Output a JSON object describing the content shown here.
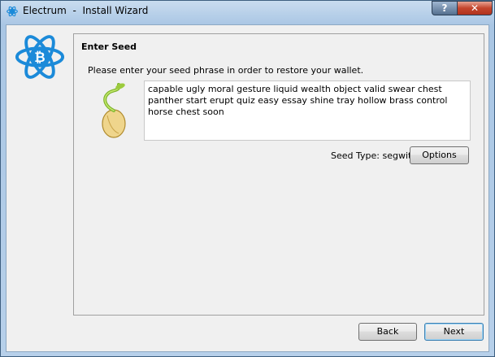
{
  "window": {
    "app_name": "Electrum",
    "separator": "-",
    "subtitle": "Install Wizard",
    "help_label": "?",
    "close_label": "✕"
  },
  "icons": {
    "app": "electrum-icon",
    "logo": "electrum-bitcoin-logo",
    "seed": "seed-sprout-icon"
  },
  "page": {
    "heading": "Enter Seed",
    "instruction": "Please enter your seed phrase in order to restore your wallet.",
    "seed_text": "capable ugly moral gesture liquid wealth object valid swear chest panther start erupt quiz easy essay shine tray hollow brass control horse chest soon",
    "seed_type_label": "Seed Type: segwit",
    "options_label": "Options"
  },
  "footer": {
    "back_label": "Back",
    "next_label": "Next"
  },
  "colors": {
    "logo_blue": "#1b8ad9",
    "title_bar": "#b7d0ea",
    "next_border": "#3c7fb1"
  }
}
